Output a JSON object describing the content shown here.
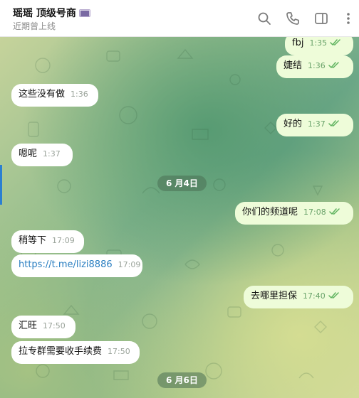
{
  "header": {
    "title": "瑶瑶 顶级号商",
    "badge": "▇▇",
    "status": "近期曾上线",
    "icons": [
      "search-icon",
      "phone-icon",
      "sidebar-toggle-icon",
      "more-vertical-icon"
    ]
  },
  "messages": [
    {
      "dir": "out",
      "text": "fbj",
      "time": "1:35",
      "read": true
    },
    {
      "dir": "out",
      "text": "婕结",
      "time": "1:36",
      "read": true
    },
    {
      "dir": "in",
      "text": "这些没有做",
      "time": "1:36"
    },
    {
      "dir": "out",
      "text": "好的",
      "time": "1:37",
      "read": true
    },
    {
      "dir": "in",
      "text": "嗯呢",
      "time": "1:37"
    },
    {
      "dir": "out",
      "text": "你们的频道呢",
      "time": "17:08",
      "read": true
    },
    {
      "dir": "in",
      "text": "稍等下",
      "time": "17:09"
    },
    {
      "dir": "in",
      "text": "https://t.me/lizi8886",
      "time": "17:09",
      "link": true
    },
    {
      "dir": "out",
      "text": "去哪里担保",
      "time": "17:40",
      "read": true
    },
    {
      "dir": "in",
      "text": "汇旺",
      "time": "17:50"
    },
    {
      "dir": "in",
      "text": "拉专群需要收手续费",
      "time": "17:50"
    }
  ],
  "dates": [
    "6 月4日",
    "6 月6日"
  ],
  "colors": {
    "outgoing_bubble": "#eefcd9",
    "incoming_bubble": "#ffffff",
    "link": "#2b7fc1",
    "read_ticks": "#5fb35f"
  }
}
